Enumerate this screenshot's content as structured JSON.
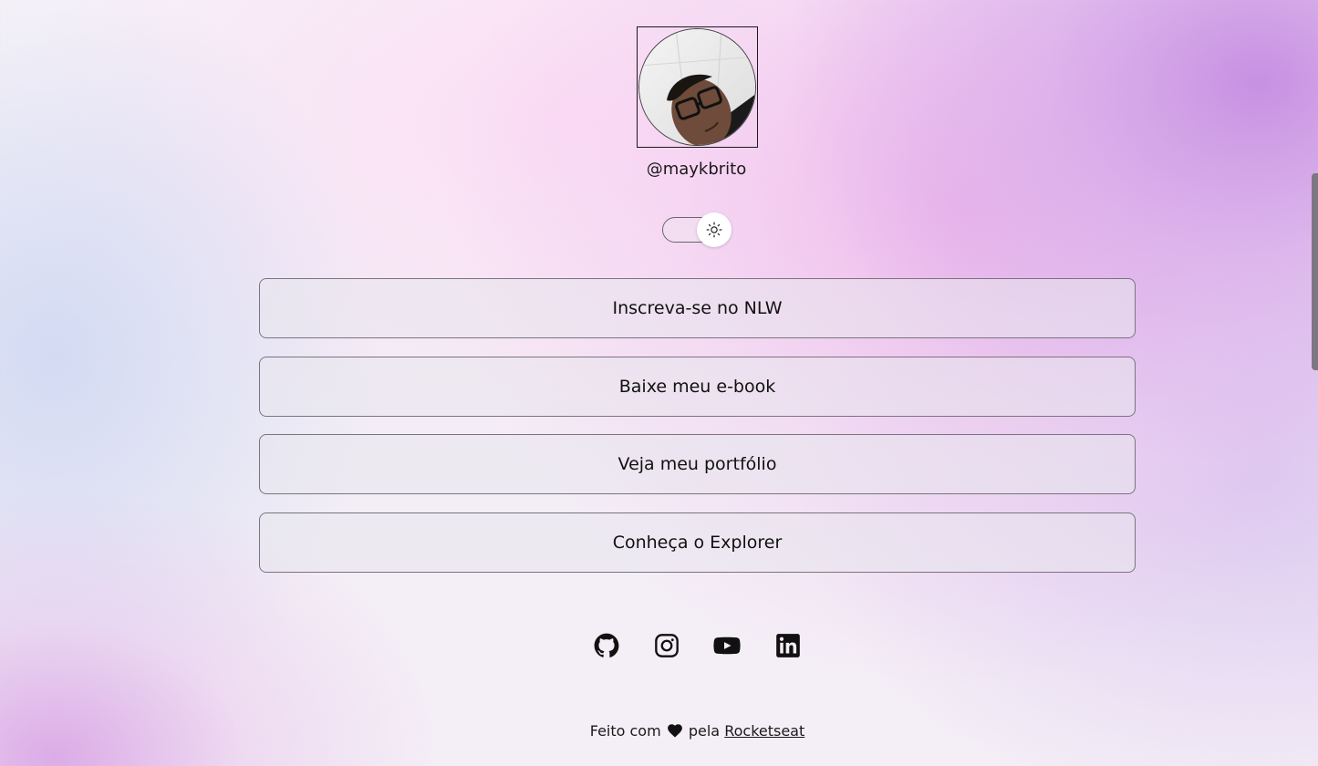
{
  "profile": {
    "username": "@maykbrito",
    "avatar_alt": "Foto de Mayk Brito"
  },
  "theme_switch": {
    "icon": "sun-icon",
    "state": "light"
  },
  "links": [
    {
      "label": "Inscreva-se no NLW"
    },
    {
      "label": "Baixe meu e-book"
    },
    {
      "label": "Veja meu portfólio"
    },
    {
      "label": "Conheça o Explorer"
    }
  ],
  "social": [
    {
      "name": "github-icon"
    },
    {
      "name": "instagram-icon"
    },
    {
      "name": "youtube-icon"
    },
    {
      "name": "linkedin-icon"
    }
  ],
  "footer": {
    "prefix": "Feito com",
    "icon": "heart-icon",
    "middle": "pela",
    "link": "Rocketseat"
  }
}
